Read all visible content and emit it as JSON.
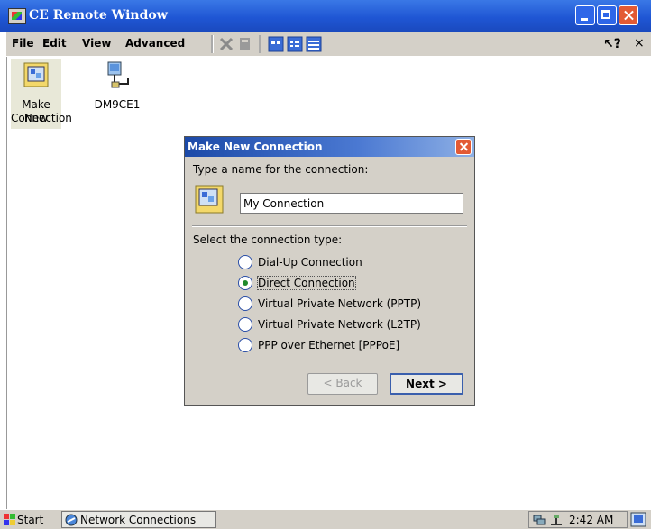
{
  "window": {
    "title": "CE Remote Window"
  },
  "menu": {
    "file": "File",
    "edit": "Edit",
    "view": "View",
    "advanced": "Advanced",
    "help": "?",
    "close": "×"
  },
  "desktop_icons": [
    {
      "label_line1": "Make New",
      "label_line2": "Connection"
    },
    {
      "label_line1": "DM9CE1"
    }
  ],
  "dialog": {
    "title": "Make New Connection",
    "name_prompt": "Type a name for the connection:",
    "name_value": "My Connection",
    "type_prompt": "Select the connection type:",
    "options": [
      {
        "label": "Dial-Up Connection",
        "checked": false
      },
      {
        "label": "Direct Connection",
        "checked": true
      },
      {
        "label": "Virtual Private Network (PPTP)",
        "checked": false
      },
      {
        "label": "Virtual Private Network (L2TP)",
        "checked": false
      },
      {
        "label": "PPP over Ethernet [PPPoE]",
        "checked": false
      }
    ],
    "back_label": "< Back",
    "next_label": "Next >"
  },
  "taskbar": {
    "start": "Start",
    "task": "Network Connections",
    "clock": "2:42 AM"
  }
}
